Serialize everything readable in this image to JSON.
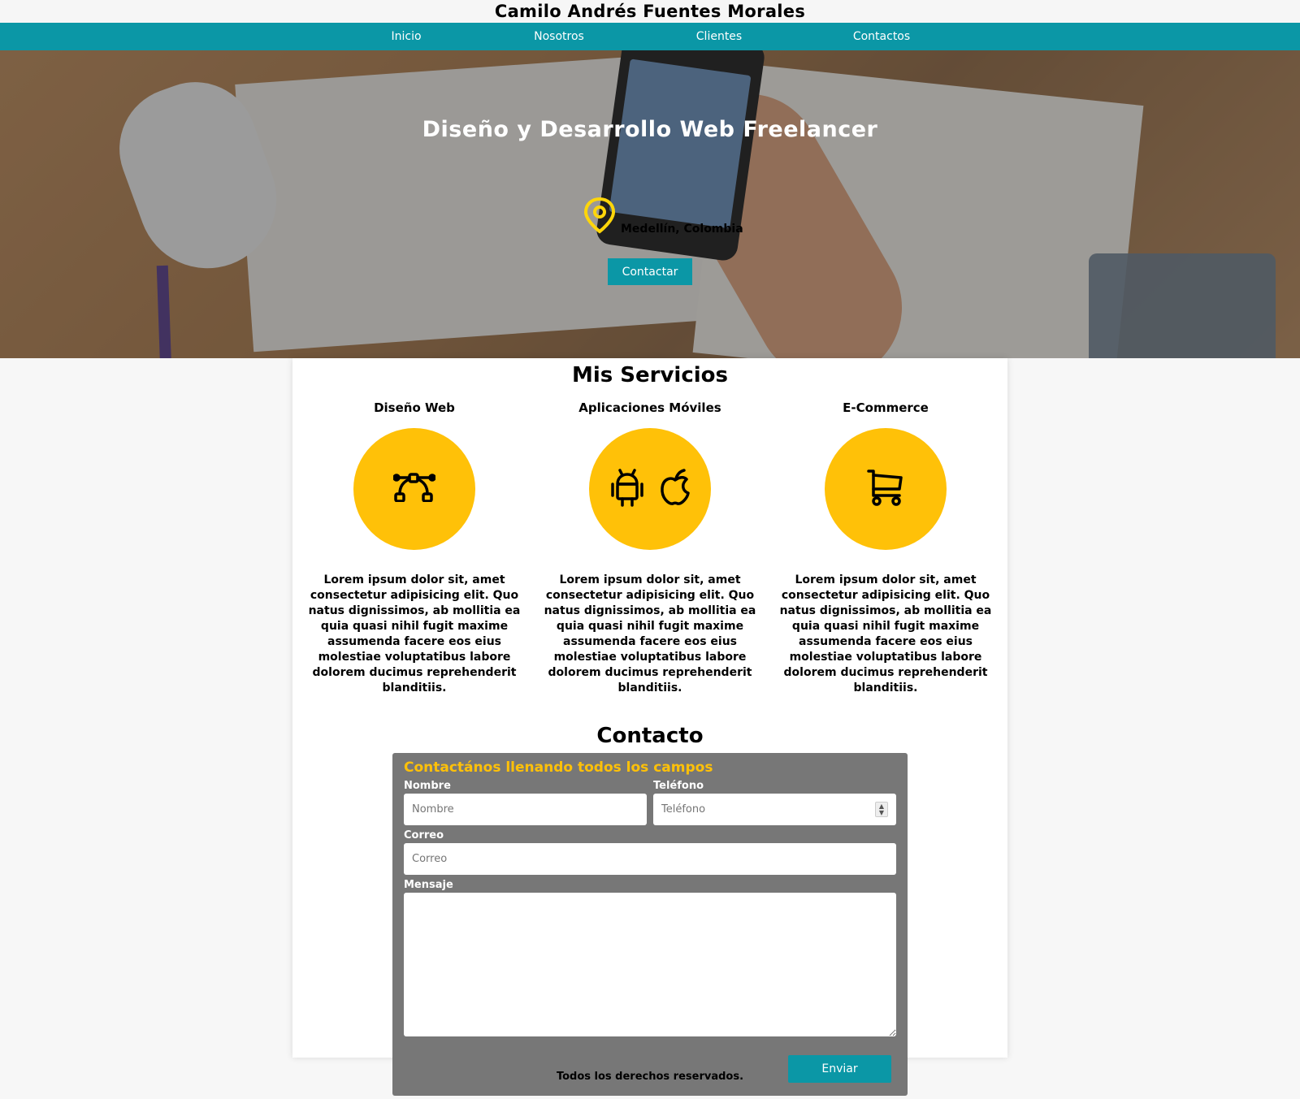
{
  "header": {
    "title": "Camilo Andrés Fuentes Morales"
  },
  "nav": {
    "items": [
      {
        "label": "Inicio"
      },
      {
        "label": "Nosotros"
      },
      {
        "label": "Clientes"
      },
      {
        "label": "Contactos"
      }
    ]
  },
  "hero": {
    "title": "Diseño y Desarrollo Web Freelancer",
    "location": "Medellín, Colombia",
    "location_icon": "map-pin-icon",
    "cta_label": "Contactar"
  },
  "services": {
    "title": "Mis Servicios",
    "items": [
      {
        "name": "Diseño Web",
        "icon": "bezier-curve-icon",
        "description": "Lorem ipsum dolor sit, amet consectetur adipisicing elit. Quo natus dignissimos, ab mollitia ea quia quasi nihil fugit maxime assumenda facere eos eius molestiae voluptatibus labore dolorem ducimus reprehenderit blanditiis."
      },
      {
        "name": "Aplicaciones Móviles",
        "icon": "android-apple-icons",
        "description": "Lorem ipsum dolor sit, amet consectetur adipisicing elit. Quo natus dignissimos, ab mollitia ea quia quasi nihil fugit maxime assumenda facere eos eius molestiae voluptatibus labore dolorem ducimus reprehenderit blanditiis."
      },
      {
        "name": "E-Commerce",
        "icon": "shopping-cart-icon",
        "description": "Lorem ipsum dolor sit, amet consectetur adipisicing elit. Quo natus dignissimos, ab mollitia ea quia quasi nihil fugit maxime assumenda facere eos eius molestiae voluptatibus labore dolorem ducimus reprehenderit blanditiis."
      }
    ]
  },
  "contact": {
    "title": "Contacto",
    "form_heading": "Contactános llenando todos los campos",
    "fields": {
      "name": {
        "label": "Nombre",
        "placeholder": "Nombre",
        "value": ""
      },
      "phone": {
        "label": "Teléfono",
        "placeholder": "Teléfono",
        "value": ""
      },
      "email": {
        "label": "Correo",
        "placeholder": "Correo",
        "value": ""
      },
      "message": {
        "label": "Mensaje",
        "value": ""
      }
    },
    "submit_label": "Enviar"
  },
  "footer": {
    "text": "Todos los derechos reservados."
  },
  "colors": {
    "accent": "#0b97a6",
    "yellow": "#ffc108",
    "form_bg": "#777777"
  }
}
